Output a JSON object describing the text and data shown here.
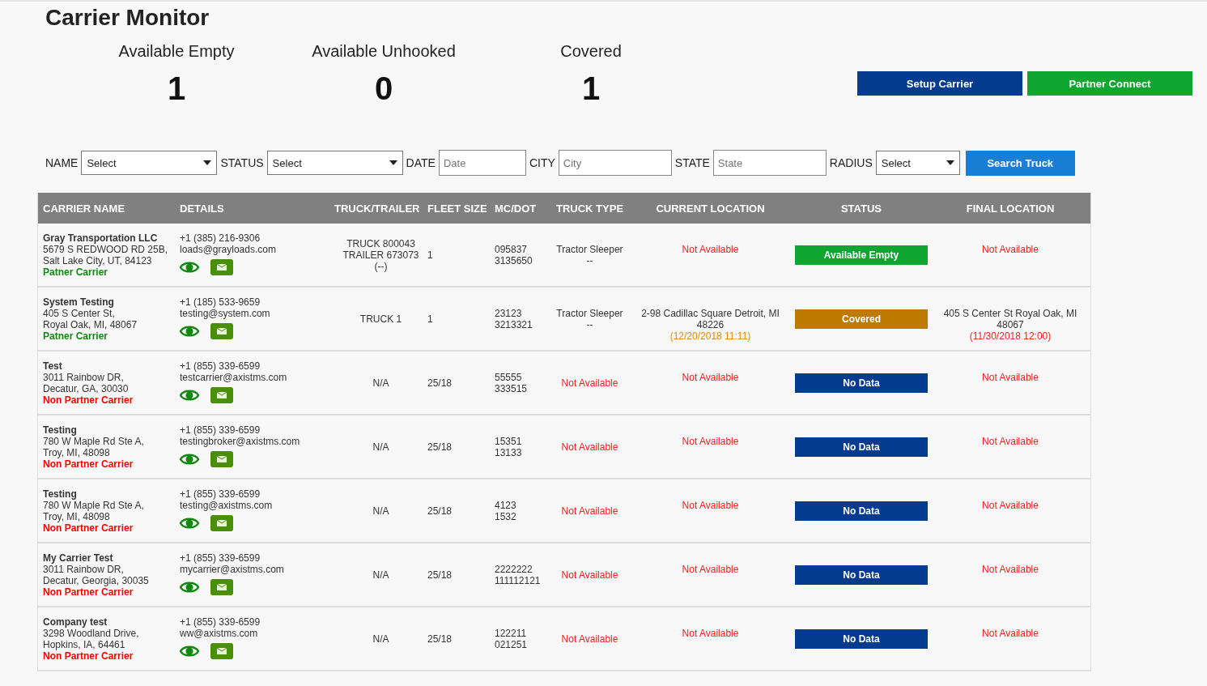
{
  "page": {
    "title": "Carrier Monitor"
  },
  "summary": [
    {
      "label": "Available Empty",
      "count": "1"
    },
    {
      "label": "Available Unhooked",
      "count": "0"
    },
    {
      "label": "Covered",
      "count": "1"
    }
  ],
  "actions": [
    {
      "label": "Setup Carrier",
      "kind": "primary"
    },
    {
      "label": "Partner Connect",
      "kind": "success"
    }
  ],
  "filters": [
    {
      "label": "NAME",
      "kind": "select",
      "value": "Select"
    },
    {
      "label": "STATUS",
      "kind": "select",
      "value": "Select"
    },
    {
      "label": "DATE",
      "kind": "input",
      "placeholder": "Date"
    },
    {
      "label": "CITY",
      "kind": "input",
      "placeholder": "City"
    },
    {
      "label": "STATE",
      "kind": "input",
      "placeholder": "State"
    },
    {
      "label": "RADIUS",
      "kind": "select",
      "value": "Select"
    }
  ],
  "search_button": "Search Truck",
  "table": {
    "columns": [
      "CARRIER NAME",
      "DETAILS",
      "TRUCK/TRAILER",
      "FLEET SIZE",
      "MC/DOT",
      "TRUCK TYPE",
      "CURRENT LOCATION",
      "STATUS",
      "FINAL LOCATION"
    ],
    "rows": [
      {
        "name": "Gray Transportation LLC",
        "address": [
          "5679 S REDWOOD RD 25B,",
          "Salt Lake City, UT, 84123"
        ],
        "partner": true,
        "partner_label": "Patner Carrier",
        "phone": "+1 (385) 216-9306",
        "email": "loads@grayloads.com",
        "truck_trailer": [
          "TRUCK 800043",
          "TRAILER 673073",
          "(--)"
        ],
        "fleet_size": "1",
        "mc_dot": [
          "095837",
          "3135650"
        ],
        "truck_type": {
          "kind": "known",
          "lines": [
            "Tractor Sleeper",
            "--"
          ]
        },
        "current_location": {
          "kind": "unknown",
          "text": "Not Available"
        },
        "status": {
          "kind": "available_empty",
          "label": "Available Empty"
        },
        "final_location": {
          "kind": "unknown",
          "text": "Not Available"
        }
      },
      {
        "name": "System Testing",
        "address": [
          "405 S Center St,",
          "Royal Oak, MI, 48067"
        ],
        "partner": true,
        "partner_label": "Patner Carrier",
        "phone": "+1 (185) 533-9659",
        "email": "testing@system.com",
        "truck_trailer": [
          "TRUCK 1"
        ],
        "fleet_size": "1",
        "mc_dot": [
          "23123",
          "3213321"
        ],
        "truck_type": {
          "kind": "known",
          "lines": [
            "Tractor Sleeper",
            "--"
          ]
        },
        "current_location": {
          "kind": "known",
          "text": "2-98 Cadillac Square Detroit, MI 48226",
          "time": "(12/20/2018 11:11)"
        },
        "status": {
          "kind": "covered",
          "label": "Covered"
        },
        "final_location": {
          "kind": "known",
          "text": "405 S Center St Royal Oak, MI 48067",
          "time": "(11/30/2018 12:00)"
        }
      },
      {
        "name": "Test",
        "address": [
          "3011 Rainbow DR,",
          "Decatur, GA, 30030"
        ],
        "partner": false,
        "partner_label": "Non Partner Carrier",
        "phone": "+1 (855) 339-6599",
        "email": "testcarrier@axistms.com",
        "truck_trailer": [
          "N/A"
        ],
        "fleet_size": "25/18",
        "mc_dot": [
          "55555",
          "333515"
        ],
        "truck_type": {
          "kind": "unknown",
          "lines": [
            "Not Available"
          ]
        },
        "current_location": {
          "kind": "unknown",
          "text": "Not Available"
        },
        "status": {
          "kind": "no_data",
          "label": "No Data"
        },
        "final_location": {
          "kind": "unknown",
          "text": "Not Available"
        }
      },
      {
        "name": "Testing",
        "address": [
          "780 W Maple Rd Ste A,",
          "Troy, MI, 48098"
        ],
        "partner": false,
        "partner_label": "Non Partner Carrier",
        "phone": "+1 (855) 339-6599",
        "email": "testingbroker@axistms.com",
        "truck_trailer": [
          "N/A"
        ],
        "fleet_size": "25/18",
        "mc_dot": [
          "15351",
          "13133"
        ],
        "truck_type": {
          "kind": "unknown",
          "lines": [
            "Not Available"
          ]
        },
        "current_location": {
          "kind": "unknown",
          "text": "Not Available"
        },
        "status": {
          "kind": "no_data",
          "label": "No Data"
        },
        "final_location": {
          "kind": "unknown",
          "text": "Not Available"
        }
      },
      {
        "name": "Testing",
        "address": [
          "780 W Maple Rd Ste A,",
          "Troy, MI, 48098"
        ],
        "partner": false,
        "partner_label": "Non Partner Carrier",
        "phone": "+1 (855) 339-6599",
        "email": "testing@axistms.com",
        "truck_trailer": [
          "N/A"
        ],
        "fleet_size": "25/18",
        "mc_dot": [
          "4123",
          "1532"
        ],
        "truck_type": {
          "kind": "unknown",
          "lines": [
            "Not Available"
          ]
        },
        "current_location": {
          "kind": "unknown",
          "text": "Not Available"
        },
        "status": {
          "kind": "no_data",
          "label": "No Data"
        },
        "final_location": {
          "kind": "unknown",
          "text": "Not Available"
        }
      },
      {
        "name": "My Carrier Test",
        "address": [
          "3011 Rainbow DR,",
          "Decatur, Georgia, 30035"
        ],
        "partner": false,
        "partner_label": "Non Partner Carrier",
        "phone": "+1 (855) 339-6599",
        "email": "mycarrier@axistms.com",
        "truck_trailer": [
          "N/A"
        ],
        "fleet_size": "25/18",
        "mc_dot": [
          "2222222",
          "111112121"
        ],
        "truck_type": {
          "kind": "unknown",
          "lines": [
            "Not Available"
          ]
        },
        "current_location": {
          "kind": "unknown",
          "text": "Not Available"
        },
        "status": {
          "kind": "no_data",
          "label": "No Data"
        },
        "final_location": {
          "kind": "unknown",
          "text": "Not Available"
        }
      },
      {
        "name": "Company test",
        "address": [
          "3298 Woodland Drive,",
          "Hopkins, IA, 64461"
        ],
        "partner": false,
        "partner_label": "Non Partner Carrier",
        "phone": "+1 (855) 339-6599",
        "email": "ww@axistms.com",
        "truck_trailer": [
          "N/A"
        ],
        "fleet_size": "25/18",
        "mc_dot": [
          "122211",
          "021251"
        ],
        "truck_type": {
          "kind": "unknown",
          "lines": [
            "Not Available"
          ]
        },
        "current_location": {
          "kind": "unknown",
          "text": "Not Available"
        },
        "status": {
          "kind": "no_data",
          "label": "No Data"
        },
        "final_location": {
          "kind": "unknown",
          "text": "Not Available"
        }
      }
    ]
  }
}
